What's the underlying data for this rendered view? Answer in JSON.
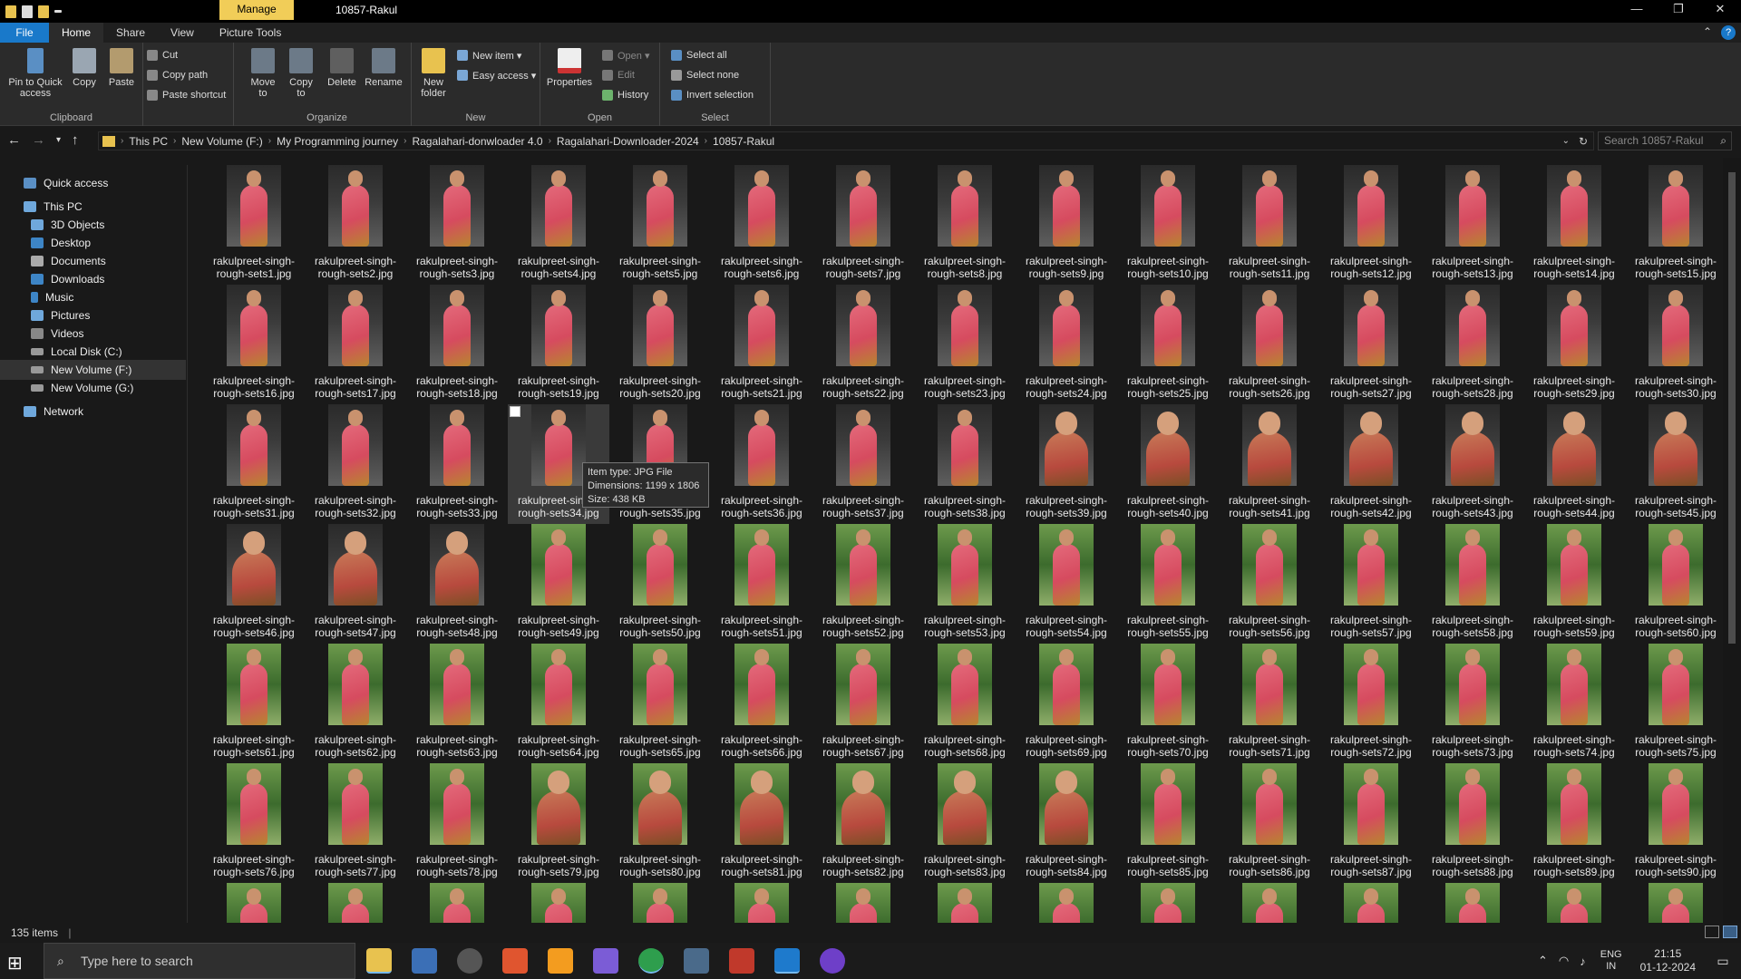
{
  "window": {
    "title": "10857-Rakul",
    "context_tab": "Manage",
    "controls": [
      "—",
      "❐",
      "✕"
    ]
  },
  "ribbon_tabs": [
    "File",
    "Home",
    "Share",
    "View",
    "Picture Tools"
  ],
  "ribbon": {
    "clipboard": {
      "label": "Clipboard",
      "pin": "Pin to Quick access",
      "copy": "Copy",
      "paste": "Paste",
      "cut": "Cut",
      "copy_path": "Copy path",
      "paste_shortcut": "Paste shortcut"
    },
    "organize": {
      "label": "Organize",
      "move_to": "Move to",
      "copy_to": "Copy to",
      "delete": "Delete",
      "rename": "Rename"
    },
    "new": {
      "label": "New",
      "new_folder": "New folder",
      "new_item": "New item ▾",
      "easy_access": "Easy access ▾"
    },
    "open": {
      "label": "Open",
      "properties": "Properties",
      "open": "Open ▾",
      "edit": "Edit",
      "history": "History"
    },
    "select": {
      "label": "Select",
      "select_all": "Select all",
      "select_none": "Select none",
      "invert": "Invert selection"
    }
  },
  "address": {
    "crumbs": [
      "This PC",
      "New Volume (F:)",
      "My Programming journey",
      "Ragalahari-donwloader 4.0",
      "Ragalahari-Downloader-2024",
      "10857-Rakul"
    ],
    "search_placeholder": "Search 10857-Rakul"
  },
  "nav": {
    "quick_access": "Quick access",
    "this_pc": "This PC",
    "items": [
      "3D Objects",
      "Desktop",
      "Documents",
      "Downloads",
      "Music",
      "Pictures",
      "Videos",
      "Local Disk (C:)",
      "New Volume (F:)",
      "New Volume (G:)"
    ],
    "network": "Network"
  },
  "files": {
    "prefix_line1": "rakulpreet-singh-",
    "prefix_line2": "rough-sets",
    "ext": ".jpg",
    "visible_count": 105,
    "selected_index": 34
  },
  "tooltip": {
    "type": "Item type: JPG File",
    "dimensions": "Dimensions: 1199 x 1806",
    "size": "Size: 438 KB"
  },
  "status": {
    "count": "135 items"
  },
  "taskbar": {
    "search_placeholder": "Type here to search",
    "lang_top": "ENG",
    "lang_bottom": "IN",
    "time": "21:15",
    "date": "01-12-2024"
  },
  "colors": {
    "accent": "#1979ca",
    "folder": "#e8c24f",
    "context_tab": "#f1cd58"
  }
}
